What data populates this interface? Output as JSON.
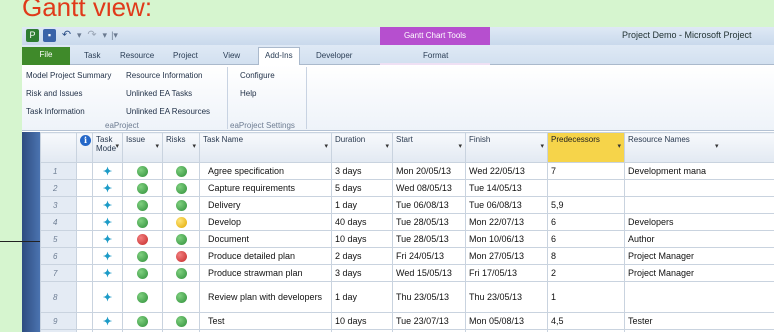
{
  "slide": {
    "title": "Gantt view:"
  },
  "window": {
    "title": "Project Demo  -  Microsoft Project",
    "contextual_header": "Gantt Chart Tools"
  },
  "tabs": [
    "File",
    "Task",
    "Resource",
    "Project",
    "View",
    "Add-Ins",
    "Developer",
    "Format"
  ],
  "ribbon": {
    "eaproject": {
      "label": "eaProject",
      "buttons": [
        "Model Project Summary",
        "Resource Information",
        "Risk and Issues",
        "Unlinked EA Tasks",
        "Task Information",
        "Unlinked EA Resources"
      ]
    },
    "settings": {
      "label": "eaProject Settings",
      "buttons": [
        "Configure",
        "Help"
      ]
    }
  },
  "table": {
    "headers": [
      "Task Mode",
      "Issue",
      "Risks",
      "Task Name",
      "Duration",
      "Start",
      "Finish",
      "Predecessors",
      "Resource Names"
    ],
    "rows": [
      {
        "id": "1",
        "issue": "green",
        "risk": "green",
        "name": "Agree specification",
        "duration": "3 days",
        "start": "Mon 20/05/13",
        "finish": "Wed 22/05/13",
        "pred": "7",
        "resource": "Development mana"
      },
      {
        "id": "2",
        "issue": "green",
        "risk": "green",
        "name": "Capture requirements",
        "duration": "5 days",
        "start": "Wed 08/05/13",
        "finish": "Tue 14/05/13",
        "pred": "",
        "resource": ""
      },
      {
        "id": "3",
        "issue": "green",
        "risk": "green",
        "name": "Delivery",
        "duration": "1 day",
        "start": "Tue 06/08/13",
        "finish": "Tue 06/08/13",
        "pred": "5,9",
        "resource": ""
      },
      {
        "id": "4",
        "issue": "green",
        "risk": "yellow",
        "name": "Develop",
        "duration": "40 days",
        "start": "Tue 28/05/13",
        "finish": "Mon 22/07/13",
        "pred": "6",
        "resource": "Developers"
      },
      {
        "id": "5",
        "issue": "red",
        "risk": "green",
        "name": "Document",
        "duration": "10 days",
        "start": "Tue 28/05/13",
        "finish": "Mon 10/06/13",
        "pred": "6",
        "resource": "Author"
      },
      {
        "id": "6",
        "issue": "green",
        "risk": "red",
        "name": "Produce detailed plan",
        "duration": "2 days",
        "start": "Fri 24/05/13",
        "finish": "Mon 27/05/13",
        "pred": "8",
        "resource": "Project Manager"
      },
      {
        "id": "7",
        "issue": "green",
        "risk": "green",
        "name": "Produce strawman plan",
        "duration": "3 days",
        "start": "Wed 15/05/13",
        "finish": "Fri 17/05/13",
        "pred": "2",
        "resource": "Project Manager"
      },
      {
        "id": "8",
        "issue": "green",
        "risk": "green",
        "name": "Review plan with developers",
        "duration": "1 day",
        "start": "Thu 23/05/13",
        "finish": "Thu 23/05/13",
        "pred": "1",
        "resource": ""
      },
      {
        "id": "9",
        "issue": "green",
        "risk": "green",
        "name": "Test",
        "duration": "10 days",
        "start": "Tue 23/07/13",
        "finish": "Mon 05/08/13",
        "pred": "4,5",
        "resource": "Tester"
      }
    ]
  },
  "icons": {
    "task_mode": "pin-icon",
    "indicator_header": "info-icon"
  },
  "colors": {
    "file_tab": "#3f8a2a",
    "contextual": "#b64fcf",
    "highlight_column": "#f6d44a",
    "title": "#e03a1a"
  }
}
